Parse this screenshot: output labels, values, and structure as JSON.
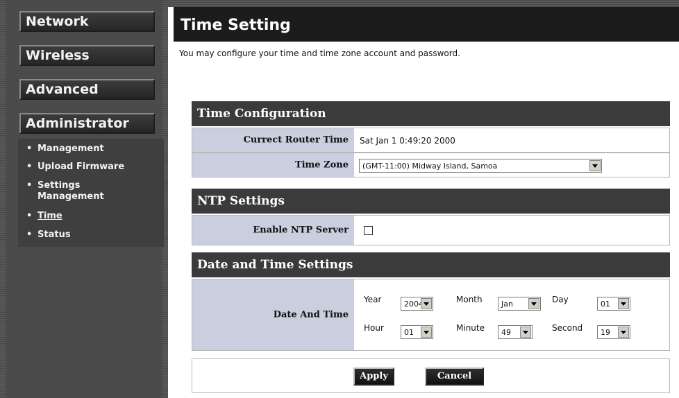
{
  "nav": {
    "network": "Network",
    "wireless": "Wireless",
    "advanced": "Advanced",
    "administrator": "Administrator",
    "subitems": [
      "Management",
      "Upload Firmware",
      "Settings",
      "Management",
      "Time",
      "Status"
    ],
    "bullet": "•"
  },
  "page": {
    "title": "Time Setting",
    "description": "You may configure your time and time zone account and password."
  },
  "time_config": {
    "header": "Time Configuration",
    "router_time_label": "Currect Router Time",
    "router_time_value": "Sat Jan 1 0:49:20 2000",
    "time_zone_label": "Time Zone",
    "time_zone_value": "(GMT-11:00) Midway Island, Samoa"
  },
  "ntp": {
    "header": "NTP Settings",
    "enable_label": "Enable NTP Server",
    "enabled": false
  },
  "datetime": {
    "header": "Date and Time Settings",
    "label": "Date And Time",
    "year_label": "Year",
    "year_value": "2004",
    "month_label": "Month",
    "month_value": "Jan",
    "day_label": "Day",
    "day_value": "01",
    "hour_label": "Hour",
    "hour_value": "01",
    "minute_label": "Minute",
    "minute_value": "49",
    "second_label": "Second",
    "second_value": "19"
  },
  "actions": {
    "apply": "Apply",
    "cancel": "Cancel"
  }
}
